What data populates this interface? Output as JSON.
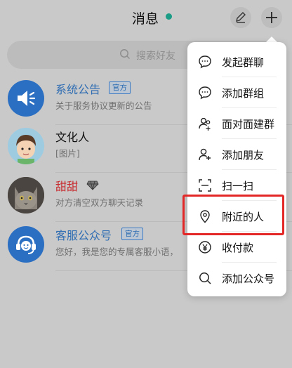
{
  "header": {
    "title": "消息"
  },
  "search": {
    "placeholder": "搜索好友"
  },
  "chats": [
    {
      "name": "系统公告",
      "badge": "官方",
      "preview": "关于服务协议更新的公告"
    },
    {
      "name": "文化人",
      "preview": "[图片]"
    },
    {
      "name": "甜甜",
      "preview": "对方清空双方聊天记录"
    },
    {
      "name": "客服公众号",
      "badge": "官方",
      "preview": "您好，我是您的专属客服小语，"
    }
  ],
  "menu": {
    "items": [
      {
        "label": "发起群聊",
        "icon": "chat-bubble-icon"
      },
      {
        "label": "添加群组",
        "icon": "group-chat-icon"
      },
      {
        "label": "面对面建群",
        "icon": "face-to-face-icon"
      },
      {
        "label": "添加朋友",
        "icon": "add-friend-icon"
      },
      {
        "label": "扫一扫",
        "icon": "scan-icon"
      },
      {
        "label": "附近的人",
        "icon": "location-pin-icon"
      },
      {
        "label": "收付款",
        "icon": "yen-icon"
      },
      {
        "label": "添加公众号",
        "icon": "search-icon"
      }
    ]
  },
  "colors": {
    "accent_blue": "#2f6db3",
    "online_green": "#1a9c86",
    "highlight_red": "#e32626"
  }
}
